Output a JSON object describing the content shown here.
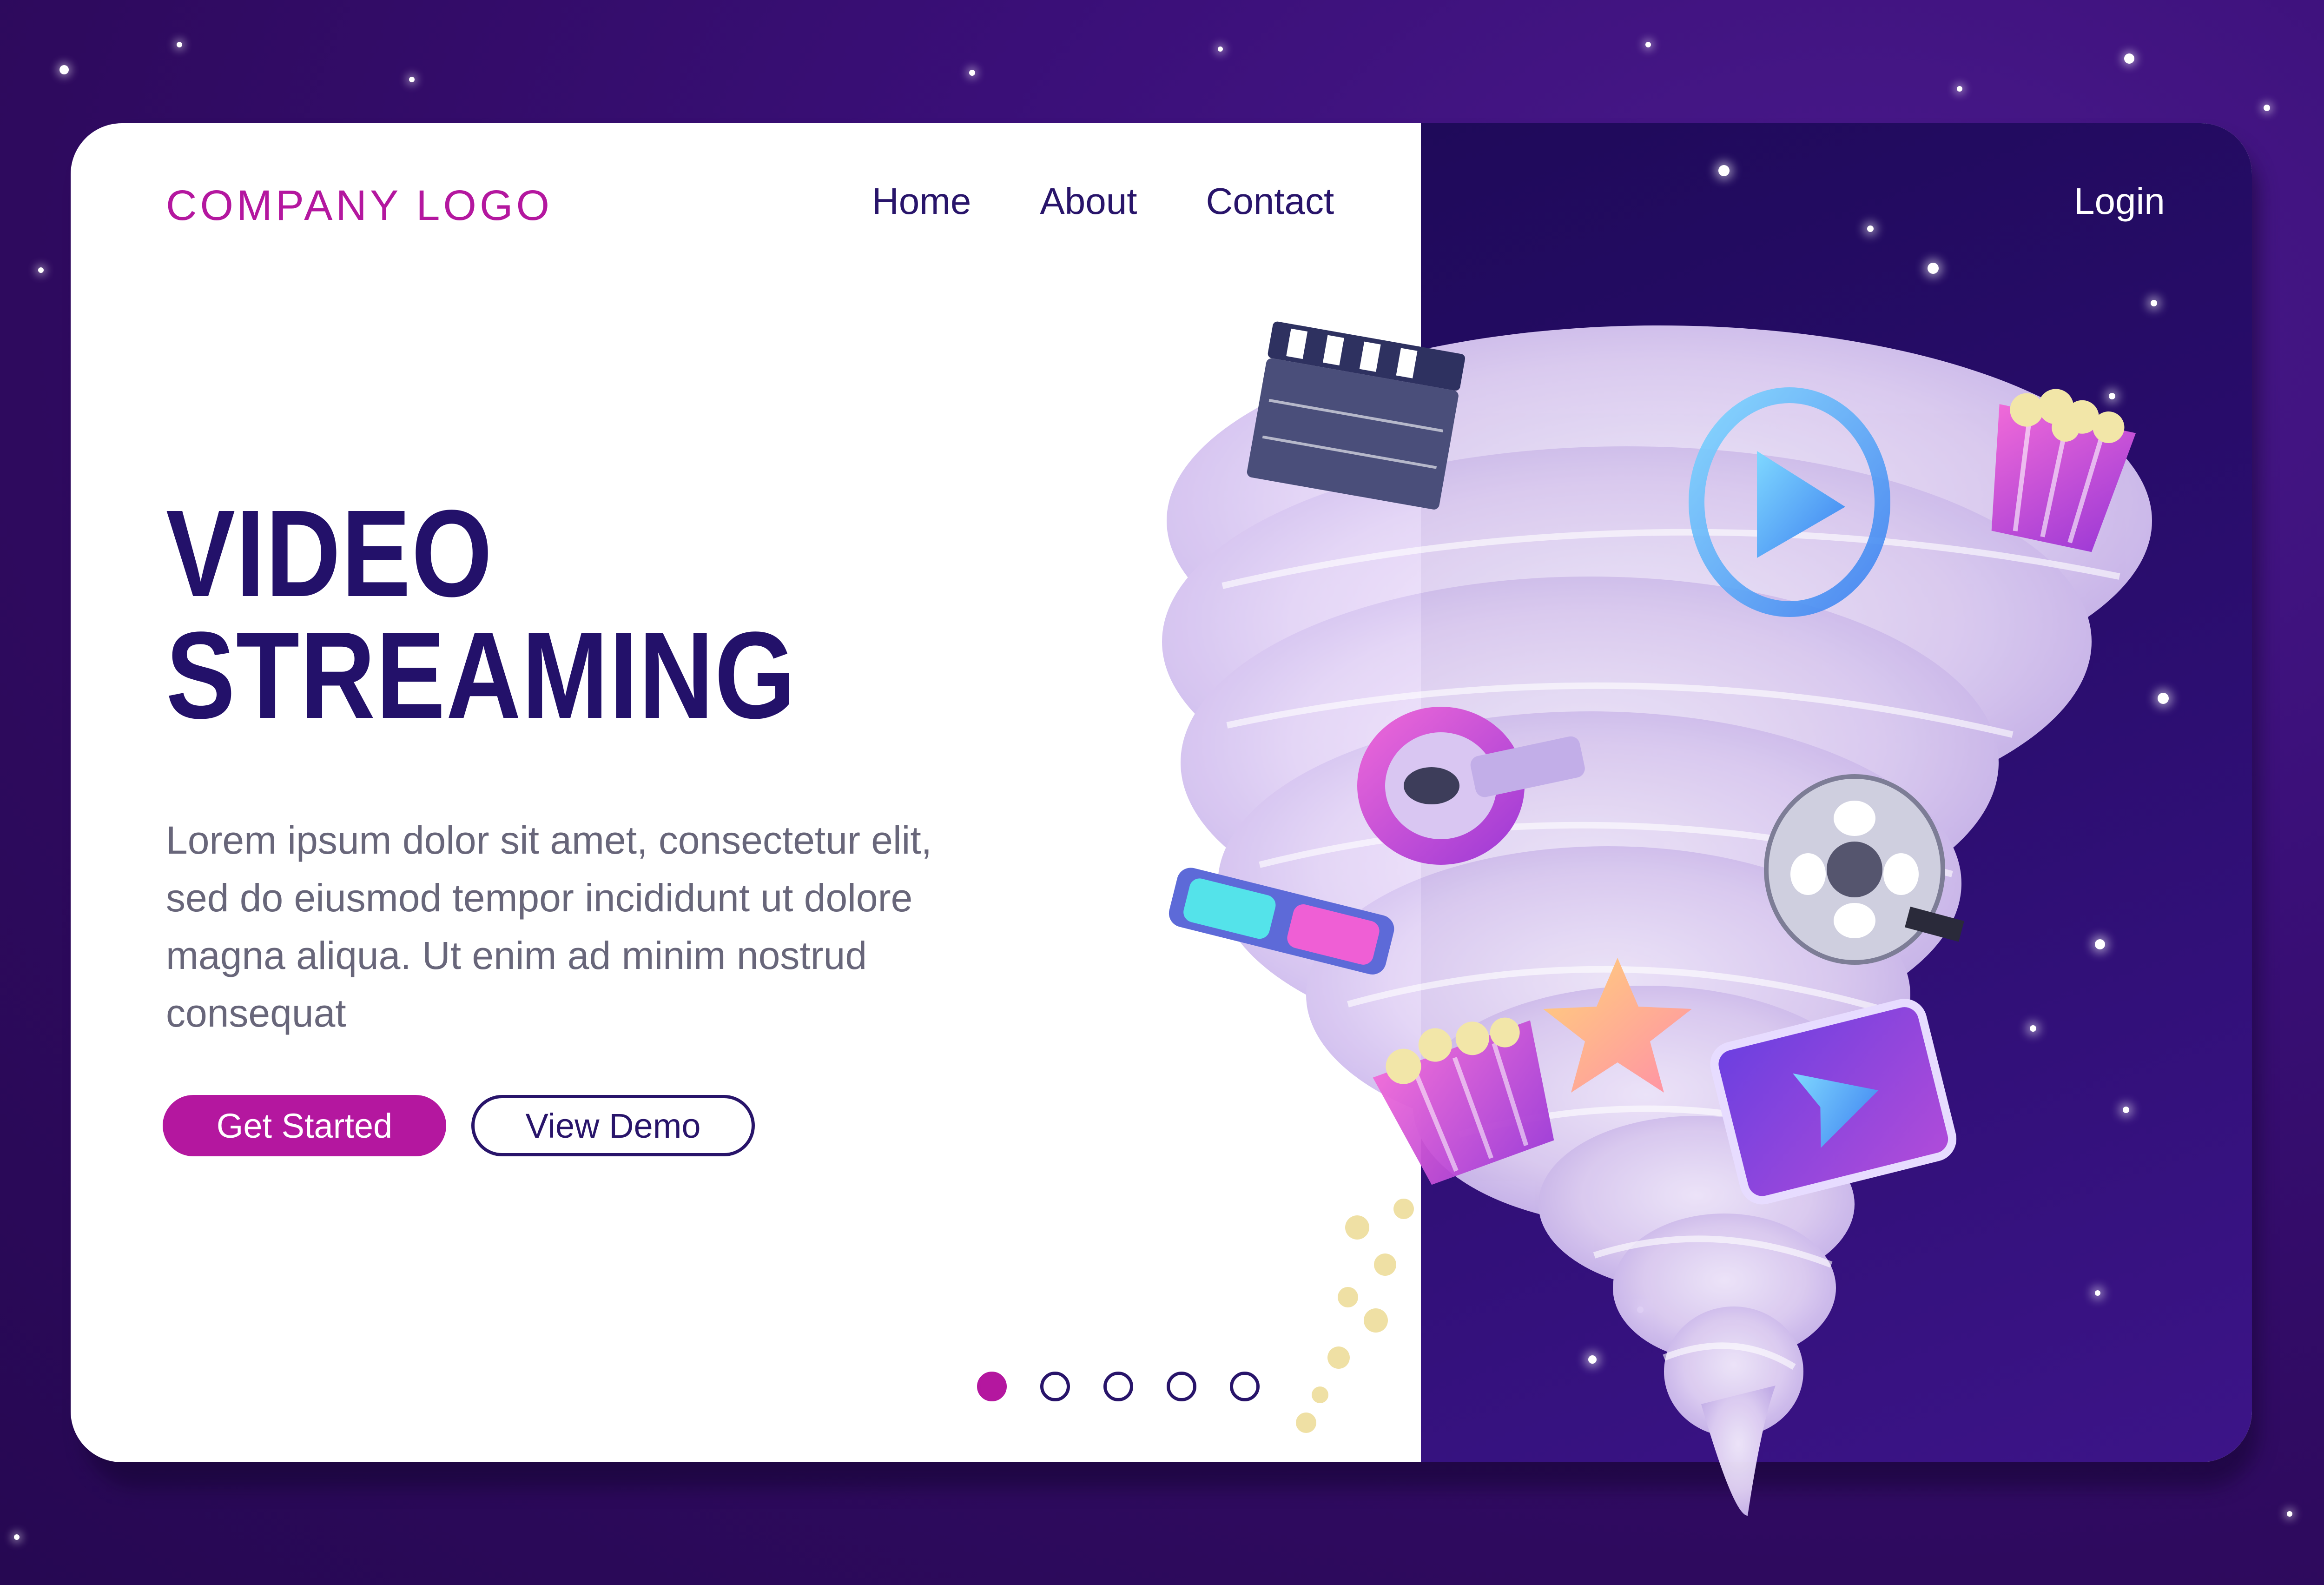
{
  "header": {
    "logo_text": "COMPANY LOGO",
    "nav": [
      {
        "label": "Home"
      },
      {
        "label": "About"
      },
      {
        "label": "Contact"
      }
    ],
    "login_label": "Login"
  },
  "hero": {
    "title_line1": "VIDEO",
    "title_line2": "STREAMING",
    "description": "Lorem ipsum dolor sit amet, consectetur elit, sed do eiusmod tempor incididunt ut dolore magna aliqua. Ut enim ad minim nostrud consequat",
    "primary_button": "Get Started",
    "secondary_button": "View Demo"
  },
  "pagination": {
    "count": 5,
    "active_index": 0
  },
  "illustration": {
    "icons": [
      "clapperboard-icon",
      "play-button-icon",
      "popcorn-icon",
      "megaphone-icon",
      "3d-glasses-icon",
      "film-reel-icon",
      "star-icon",
      "smartphone-play-icon",
      "popcorn-bucket-icon"
    ]
  },
  "colors": {
    "accent": "#b4179f",
    "navy": "#28146a",
    "title": "#23116a",
    "body_text": "#68667a",
    "background": "#3a0f78",
    "panel_dark": "#2a0d6e"
  }
}
